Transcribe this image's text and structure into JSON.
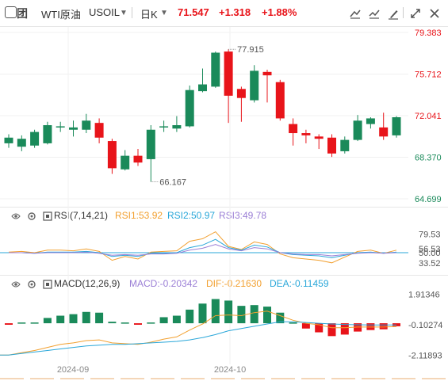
{
  "header": {
    "name": "WTI原油",
    "code": "USOIL",
    "period": "日K",
    "price": "71.547",
    "change": "+1.318",
    "change_pct": "+1.88%",
    "up_color": "#e8141a",
    "down_color": "#1a8a5a"
  },
  "rsi": {
    "title": "RSI(7,14,21)",
    "rsi1": "RSI1:53.92",
    "rsi2": "RSI2:50.97",
    "rsi3": "RSI3:49.78"
  },
  "macd": {
    "title": "MACD(12,26,9)",
    "macd": "MACD:-0.20342",
    "dif": "DIF:-0.21630",
    "dea": "DEA:-0.11459"
  },
  "chart_data": [
    {
      "type": "candlestick",
      "y_ticks": [
        "79.383",
        "75.712",
        "72.041",
        "68.370",
        "64.699"
      ],
      "ylim": [
        64.699,
        79.383
      ],
      "x_labels": [
        "2024-09",
        "2024-10"
      ],
      "annotations": [
        "77.915",
        "66.167"
      ],
      "candles": [
        {
          "o": 69.6,
          "c": 70.1,
          "h": 70.4,
          "l": 69.2
        },
        {
          "o": 69.3,
          "c": 70.0,
          "h": 70.3,
          "l": 68.9
        },
        {
          "o": 69.4,
          "c": 70.6,
          "h": 70.8,
          "l": 69.2
        },
        {
          "o": 69.6,
          "c": 71.2,
          "h": 71.5,
          "l": 69.5
        },
        {
          "o": 71.1,
          "c": 71.1,
          "h": 71.5,
          "l": 70.6
        },
        {
          "o": 70.8,
          "c": 71.0,
          "h": 71.6,
          "l": 70.2
        },
        {
          "o": 70.8,
          "c": 71.6,
          "h": 72.2,
          "l": 70.5
        },
        {
          "o": 71.4,
          "c": 70.1,
          "h": 71.8,
          "l": 69.6
        },
        {
          "o": 69.8,
          "c": 67.4,
          "h": 70.0,
          "l": 66.9
        },
        {
          "o": 67.3,
          "c": 68.5,
          "h": 69.0,
          "l": 67.2
        },
        {
          "o": 68.5,
          "c": 67.9,
          "h": 69.1,
          "l": 67.6
        },
        {
          "o": 68.2,
          "c": 70.8,
          "h": 71.2,
          "l": 66.2
        },
        {
          "o": 71.0,
          "c": 71.1,
          "h": 71.6,
          "l": 70.6
        },
        {
          "o": 70.9,
          "c": 71.2,
          "h": 72.0,
          "l": 70.6
        },
        {
          "o": 71.1,
          "c": 74.3,
          "h": 74.7,
          "l": 71.0
        },
        {
          "o": 74.2,
          "c": 74.8,
          "h": 76.2,
          "l": 74.1
        },
        {
          "o": 74.6,
          "c": 77.6,
          "h": 77.7,
          "l": 74.5
        },
        {
          "o": 77.7,
          "c": 73.8,
          "h": 77.9,
          "l": 71.4
        },
        {
          "o": 74.4,
          "c": 73.6,
          "h": 74.6,
          "l": 71.5
        },
        {
          "o": 73.4,
          "c": 76.0,
          "h": 76.5,
          "l": 73.2
        },
        {
          "o": 75.9,
          "c": 75.6,
          "h": 76.1,
          "l": 73.2
        },
        {
          "o": 75.0,
          "c": 71.8,
          "h": 75.2,
          "l": 71.6
        },
        {
          "o": 71.3,
          "c": 70.5,
          "h": 71.8,
          "l": 69.4
        },
        {
          "o": 70.5,
          "c": 70.3,
          "h": 70.8,
          "l": 69.6
        },
        {
          "o": 70.2,
          "c": 70.0,
          "h": 70.4,
          "l": 69.1
        },
        {
          "o": 70.1,
          "c": 68.7,
          "h": 70.4,
          "l": 68.4
        },
        {
          "o": 68.9,
          "c": 69.9,
          "h": 70.2,
          "l": 68.7
        },
        {
          "o": 69.9,
          "c": 71.6,
          "h": 72.1,
          "l": 69.8
        },
        {
          "o": 71.3,
          "c": 71.8,
          "h": 71.9,
          "l": 70.9
        },
        {
          "o": 71.0,
          "c": 70.2,
          "h": 72.3,
          "l": 69.9
        },
        {
          "o": 70.3,
          "c": 71.9,
          "h": 72.0,
          "l": 70.1
        }
      ]
    },
    {
      "type": "line",
      "name": "RSI",
      "y_ticks": [
        "79.53",
        "56.53",
        "50.00",
        "33.52"
      ],
      "ylim": [
        20,
        95
      ],
      "reference_line": 50.0,
      "series": [
        {
          "name": "RSI1",
          "color": "#f2a030",
          "values": [
            51,
            52,
            50,
            54,
            54,
            53,
            56,
            52,
            38,
            44,
            40,
            51,
            52,
            53,
            68,
            72,
            83,
            60,
            55,
            67,
            63,
            48,
            42,
            40,
            38,
            34,
            43,
            52,
            54,
            49,
            54
          ]
        },
        {
          "name": "RSI2",
          "color": "#2aa7d9",
          "values": [
            50,
            50,
            49,
            51,
            51,
            51,
            52,
            50,
            44,
            46,
            44,
            49,
            49,
            50,
            58,
            62,
            71,
            58,
            54,
            62,
            59,
            50,
            47,
            46,
            45,
            42,
            46,
            50,
            51,
            49,
            51
          ]
        },
        {
          "name": "RSI3",
          "color": "#9b7fd6",
          "values": [
            50,
            50,
            49,
            50,
            50,
            50,
            51,
            49,
            46,
            47,
            46,
            48,
            48,
            49,
            54,
            57,
            63,
            56,
            53,
            58,
            56,
            50,
            48,
            47,
            47,
            45,
            47,
            49,
            50,
            49,
            50
          ]
        }
      ]
    },
    {
      "type": "bar",
      "name": "MACD",
      "y_ticks": [
        "1.91346",
        "-0.10274",
        "-2.11893"
      ],
      "ylim": [
        -2.3,
        2.1
      ],
      "histogram": [
        -0.1,
        0.05,
        0.05,
        0.35,
        0.5,
        0.6,
        0.75,
        0.7,
        0.1,
        0.05,
        -0.1,
        0.05,
        0.4,
        0.5,
        0.9,
        1.3,
        1.6,
        1.5,
        1.15,
        1.2,
        1.1,
        0.7,
        0.05,
        -0.35,
        -0.6,
        -0.85,
        -0.75,
        -0.55,
        -0.45,
        -0.4,
        -0.2
      ],
      "dif": [
        -2.1,
        -1.95,
        -1.8,
        -1.6,
        -1.4,
        -1.3,
        -1.15,
        -1.1,
        -1.3,
        -1.35,
        -1.4,
        -1.25,
        -1.05,
        -0.9,
        -0.45,
        -0.05,
        0.5,
        0.55,
        0.5,
        0.7,
        0.8,
        0.5,
        0.2,
        0.0,
        -0.1,
        -0.3,
        -0.3,
        -0.25,
        -0.25,
        -0.25,
        -0.22
      ],
      "dea": [
        -2.1,
        -2.0,
        -1.9,
        -1.8,
        -1.7,
        -1.6,
        -1.5,
        -1.45,
        -1.4,
        -1.4,
        -1.35,
        -1.3,
        -1.25,
        -1.2,
        -1.1,
        -0.95,
        -0.75,
        -0.5,
        -0.35,
        -0.2,
        -0.05,
        0.1,
        0.1,
        0.05,
        0.0,
        -0.05,
        -0.08,
        -0.1,
        -0.11,
        -0.11,
        -0.11
      ],
      "dif_color": "#f2a030",
      "dea_color": "#2aa7d9"
    }
  ]
}
